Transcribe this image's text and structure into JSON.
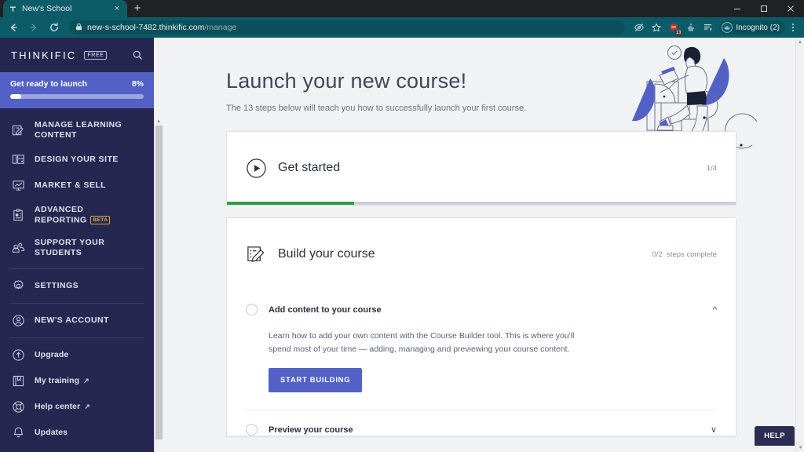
{
  "browser": {
    "tab": {
      "title": "New's School",
      "favicon": "thinkific-favicon",
      "close_label": "×"
    },
    "new_tab_label": "+",
    "window_controls": {
      "minimize": "–",
      "maximize": "❐",
      "close": "✕"
    },
    "nav": {
      "back": "←",
      "forward": "→",
      "reload": "⟳"
    },
    "omnibox": {
      "lock_icon": "lock-icon",
      "domain": "new-s-school-7482.thinkific.com",
      "path": "/manage"
    },
    "toolbar_icons": [
      {
        "name": "eye-off-icon",
        "badge": ""
      },
      {
        "name": "bookmark-star-icon",
        "badge": ""
      },
      {
        "name": "adblock-icon",
        "badge": "13"
      },
      {
        "name": "extensions-puzzle-icon",
        "badge": ""
      },
      {
        "name": "reading-list-icon",
        "badge": ""
      }
    ],
    "incognito": {
      "label": "Incognito (2)",
      "icon": "incognito-spy-icon"
    },
    "menu_icon": "kebab-menu-icon"
  },
  "sidebar": {
    "brand": "THINKIFIC",
    "plan_tag": "FREE",
    "search_icon": "search-icon",
    "launch": {
      "label": "Get ready to launch",
      "percent_label": "8%",
      "percent_value": 8
    },
    "items": [
      {
        "label": "MANAGE LEARNING CONTENT",
        "icon": "content-edit-icon",
        "badge": "",
        "external": false
      },
      {
        "label": "DESIGN YOUR SITE",
        "icon": "layout-icon",
        "badge": "",
        "external": false
      },
      {
        "label": "MARKET & SELL",
        "icon": "chart-board-icon",
        "badge": "",
        "external": false
      },
      {
        "label": "ADVANCED REPORTING",
        "icon": "clipboard-report-icon",
        "badge": "BETA",
        "external": false
      },
      {
        "label": "SUPPORT YOUR STUDENTS",
        "icon": "people-icon",
        "badge": "",
        "external": false
      },
      {
        "label": "SETTINGS",
        "icon": "gear-icon",
        "badge": "",
        "external": false
      },
      {
        "label": "NEW'S ACCOUNT",
        "icon": "user-circle-icon",
        "badge": "",
        "external": false
      },
      {
        "label": "Upgrade",
        "icon": "arrow-up-circle-icon",
        "badge": "",
        "external": false
      },
      {
        "label": "My training",
        "icon": "book-icon",
        "badge": "",
        "external": true
      },
      {
        "label": "Help center",
        "icon": "lifebuoy-icon",
        "badge": "",
        "external": true
      },
      {
        "label": "Updates",
        "icon": "bell-icon",
        "badge": "",
        "external": false
      }
    ],
    "external_arrow": "↗"
  },
  "main": {
    "heading": "Launch your new course!",
    "subheading": "The 13 steps below will teach you how to successfully launch your first course.",
    "illustration": "person-with-laptop-climbing-steps",
    "cards": [
      {
        "title": "Get started",
        "icon": "play-circle-icon",
        "meta": "1/4",
        "progress_percent": 25,
        "progress_color": "#2e9c48",
        "steps": []
      },
      {
        "title": "Build your course",
        "icon": "course-edit-icon",
        "meta_count": "0/2",
        "meta_suffix": "steps complete",
        "steps": [
          {
            "title": "Add content to your course",
            "expanded": true,
            "chevron": "^",
            "description": "Learn how to add your own content with the Course Builder tool. This is where you'll spend most of your time — adding, managing and previewing your course content.",
            "button": "START BUILDING"
          },
          {
            "title": "Preview your course",
            "expanded": false,
            "chevron": "∨",
            "description": "",
            "button": ""
          }
        ]
      }
    ],
    "help_button": "HELP"
  },
  "colors": {
    "sidebar_bg": "#252750",
    "accent_purple": "#5361c6",
    "progress_green": "#2e9c48",
    "beta_gold": "#e0a33a",
    "browser_chrome": "#0c5c68"
  }
}
